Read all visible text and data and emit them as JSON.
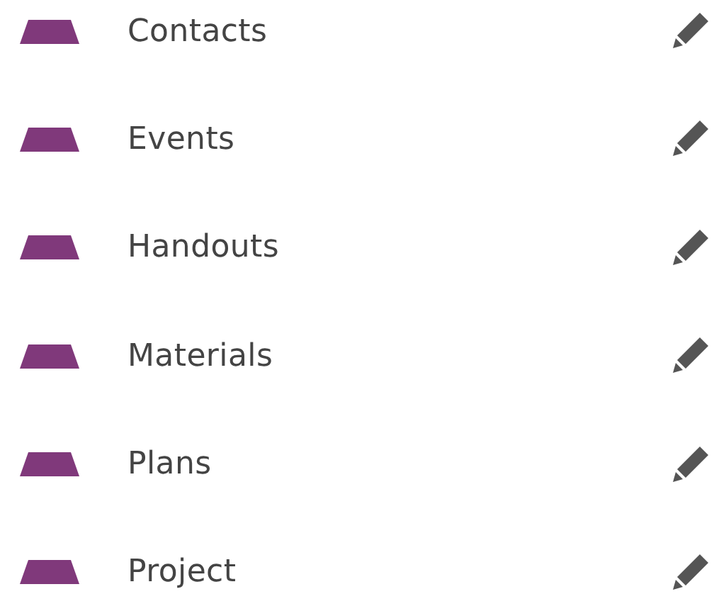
{
  "sections": [
    {
      "name": "Contacts",
      "color": "#80397b"
    },
    {
      "name": "Events",
      "color": "#80397b"
    },
    {
      "name": "Handouts",
      "color": "#80397b"
    },
    {
      "name": "Materials",
      "color": "#80397b"
    },
    {
      "name": "Plans",
      "color": "#80397b"
    },
    {
      "name": "Project",
      "color": "#80397b"
    }
  ]
}
